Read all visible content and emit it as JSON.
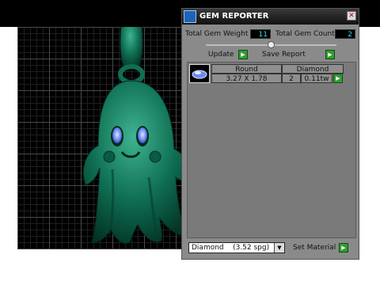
{
  "panel": {
    "title": "GEM REPORTER",
    "total_weight_label": "Total Gem Weight",
    "total_weight_value": "11",
    "total_count_label": "Total Gem Count",
    "total_count_value": "2",
    "update_label": "Update",
    "save_report_label": "Save Report",
    "table": {
      "col_shape": "Round",
      "col_material": "Diamond",
      "row": {
        "size": "3.27 X 1.78",
        "count": "2",
        "weight": "0.11tw"
      }
    },
    "material_select": "Diamond    (3.52 spg)",
    "set_material_label": "Set Material"
  },
  "colors": {
    "model": "#0f6e53",
    "eyes": "#6b8cf0",
    "grid": "#4a4a4a",
    "accent_button": "#2f9e2f"
  }
}
